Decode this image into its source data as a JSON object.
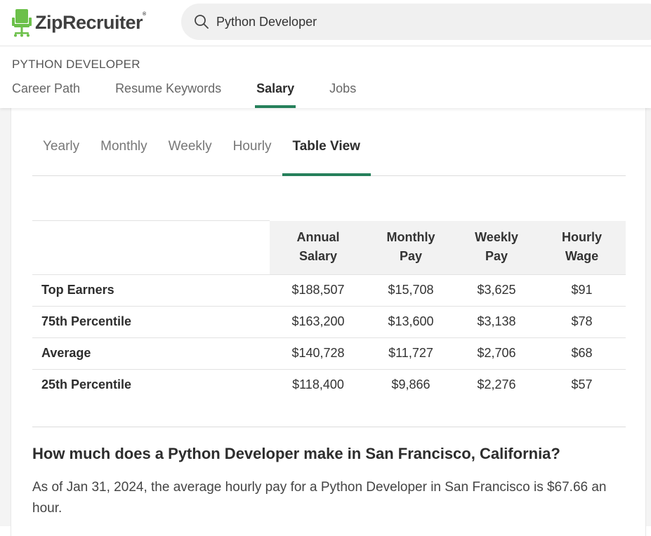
{
  "header": {
    "logo_text": "ZipRecruiter",
    "logo_reg": "®",
    "brand_color": "#6cc04a",
    "search": {
      "value": "Python Developer",
      "placeholder": ""
    }
  },
  "subheader": {
    "job_title": "PYTHON DEVELOPER",
    "tabs": [
      {
        "label": "Career Path"
      },
      {
        "label": "Resume Keywords"
      },
      {
        "label": "Salary",
        "active": true
      },
      {
        "label": "Jobs"
      }
    ],
    "accent_color": "#26805b"
  },
  "view_tabs": [
    {
      "label": "Yearly"
    },
    {
      "label": "Monthly"
    },
    {
      "label": "Weekly"
    },
    {
      "label": "Hourly"
    },
    {
      "label": "Table View",
      "active": true
    }
  ],
  "table": {
    "headers": [
      {
        "line1": "Annual",
        "line2": "Salary"
      },
      {
        "line1": "Monthly",
        "line2": "Pay"
      },
      {
        "line1": "Weekly",
        "line2": "Pay"
      },
      {
        "line1": "Hourly",
        "line2": "Wage"
      }
    ],
    "rows": [
      {
        "label": "Top Earners",
        "values": [
          "$188,507",
          "$15,708",
          "$3,625",
          "$91"
        ]
      },
      {
        "label": "75th Percentile",
        "values": [
          "$163,200",
          "$13,600",
          "$3,138",
          "$78"
        ]
      },
      {
        "label": "Average",
        "values": [
          "$140,728",
          "$11,727",
          "$2,706",
          "$68"
        ]
      },
      {
        "label": "25th Percentile",
        "values": [
          "$118,400",
          "$9,866",
          "$2,276",
          "$57"
        ]
      }
    ]
  },
  "content": {
    "question": "How much does a Python Developer make in San Francisco, California?",
    "answer": "As of Jan 31, 2024, the average hourly pay for a Python Developer in San Francisco is $67.66 an hour."
  }
}
